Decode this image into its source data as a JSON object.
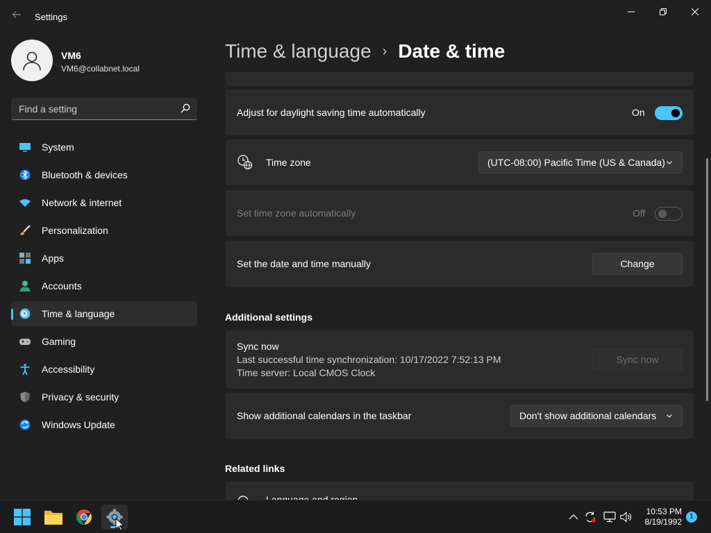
{
  "app": {
    "title": "Settings"
  },
  "profile": {
    "name": "VM6",
    "email": "VM6@collabnet.local"
  },
  "search": {
    "placeholder": "Find a setting"
  },
  "sidebar": {
    "items": [
      {
        "label": "System",
        "icon": "system-icon"
      },
      {
        "label": "Bluetooth & devices",
        "icon": "bluetooth-icon"
      },
      {
        "label": "Network & internet",
        "icon": "wifi-icon"
      },
      {
        "label": "Personalization",
        "icon": "brush-icon"
      },
      {
        "label": "Apps",
        "icon": "apps-icon"
      },
      {
        "label": "Accounts",
        "icon": "accounts-icon"
      },
      {
        "label": "Time & language",
        "icon": "clock-globe-icon",
        "active": true
      },
      {
        "label": "Gaming",
        "icon": "gamepad-icon"
      },
      {
        "label": "Accessibility",
        "icon": "accessibility-icon"
      },
      {
        "label": "Privacy & security",
        "icon": "shield-icon"
      },
      {
        "label": "Windows Update",
        "icon": "update-icon"
      }
    ]
  },
  "header": {
    "parent": "Time & language",
    "separator": "›",
    "current": "Date & time"
  },
  "main": {
    "dst": {
      "label": "Adjust for daylight saving time automatically",
      "state": "On"
    },
    "timezone": {
      "label": "Time zone",
      "value": "(UTC-08:00) Pacific Time (US & Canada)"
    },
    "tz_auto": {
      "label": "Set time zone automatically",
      "state": "Off"
    },
    "manual": {
      "label": "Set the date and time manually",
      "button": "Change"
    },
    "additional_title": "Additional settings",
    "sync": {
      "title": "Sync now",
      "last": "Last successful time synchronization: 10/17/2022 7:52:13 PM",
      "server": "Time server: Local CMOS Clock",
      "button": "Sync now"
    },
    "calendars": {
      "label": "Show additional calendars in the taskbar",
      "value": "Don't show additional calendars"
    },
    "related_title": "Related links",
    "related_item": "Language and region"
  },
  "taskbar": {
    "time": "10:53 PM",
    "date": "8/19/1992",
    "notifications": "1"
  },
  "colors": {
    "accent": "#4cc2ff",
    "background": "#202020",
    "card": "#2b2b2b"
  }
}
